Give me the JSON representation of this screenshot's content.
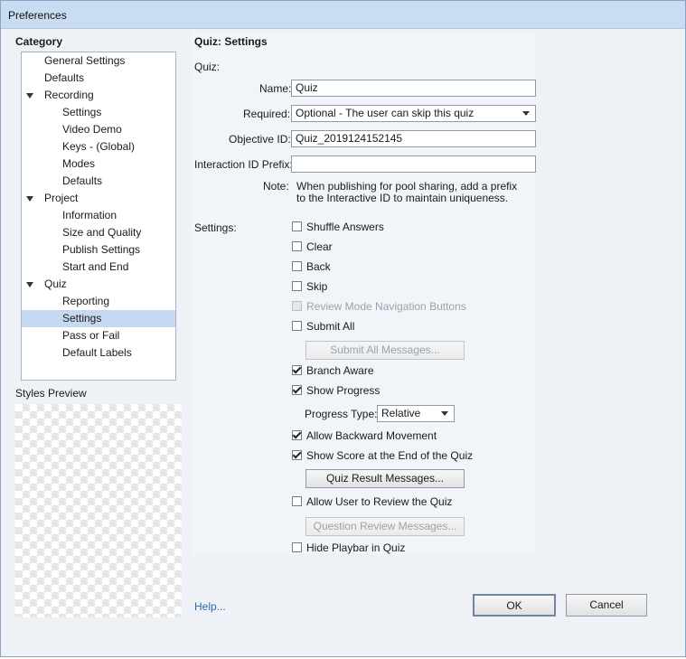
{
  "window": {
    "title": "Preferences"
  },
  "category": {
    "heading": "Category",
    "items": [
      {
        "label": "General Settings",
        "level": 1
      },
      {
        "label": "Defaults",
        "level": 1
      },
      {
        "label": "Recording",
        "level": 1
      },
      {
        "label": "Settings",
        "level": 2
      },
      {
        "label": "Video Demo",
        "level": 2
      },
      {
        "label": "Keys - (Global)",
        "level": 2
      },
      {
        "label": "Modes",
        "level": 2
      },
      {
        "label": "Defaults",
        "level": 2
      },
      {
        "label": "Project",
        "level": 1
      },
      {
        "label": "Information",
        "level": 2
      },
      {
        "label": "Size and Quality",
        "level": 2
      },
      {
        "label": "Publish Settings",
        "level": 2
      },
      {
        "label": "Start and End",
        "level": 2
      },
      {
        "label": "Quiz",
        "level": 1
      },
      {
        "label": "Reporting",
        "level": 2
      },
      {
        "label": "Settings",
        "level": 2,
        "selected": true
      },
      {
        "label": "Pass or Fail",
        "level": 2
      },
      {
        "label": "Default Labels",
        "level": 2
      }
    ],
    "styles_preview_label": "Styles Preview"
  },
  "panel": {
    "title": "Quiz: Settings",
    "quiz_label": "Quiz:",
    "name_label": "Name:",
    "name_value": "Quiz",
    "required_label": "Required:",
    "required_value": "Optional - The user can skip this quiz",
    "objective_label": "Objective ID:",
    "objective_value": "Quiz_2019124152145",
    "interaction_label": "Interaction ID Prefix:",
    "interaction_value": "",
    "note_label": "Note:",
    "note_line1": "When publishing for pool sharing, add a prefix",
    "note_line2": "to the Interactive ID to maintain uniqueness.",
    "settings_label": "Settings:",
    "shuffle_answers": "Shuffle Answers",
    "clear": "Clear",
    "back": "Back",
    "skip": "Skip",
    "review_mode_nav": "Review Mode Navigation Buttons",
    "submit_all": "Submit All",
    "submit_all_messages": "Submit All Messages...",
    "branch_aware": "Branch Aware",
    "show_progress": "Show Progress",
    "progress_type_label": "Progress Type:",
    "progress_type_value": "Relative",
    "allow_backward": "Allow Backward Movement",
    "show_score": "Show Score at the End of the Quiz",
    "quiz_result_messages": "Quiz Result Messages...",
    "allow_review": "Allow User to Review the Quiz",
    "question_review_messages": "Question Review Messages...",
    "hide_playbar": "Hide Playbar in Quiz"
  },
  "footer": {
    "help": "Help...",
    "ok": "OK",
    "cancel": "Cancel"
  }
}
